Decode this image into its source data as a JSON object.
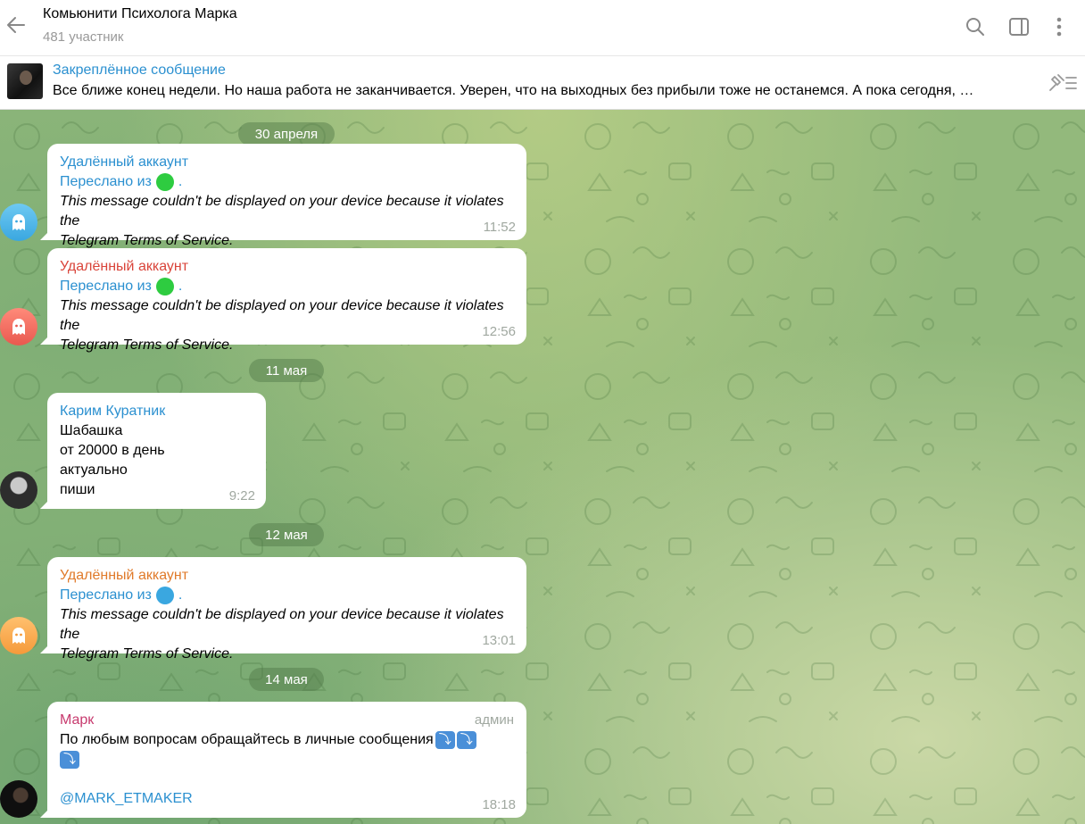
{
  "header": {
    "title": "Комьюнити Психолога Марка",
    "subtitle": "481 участник"
  },
  "pinned": {
    "title": "Закреплённое сообщение",
    "text": "Все ближе конец недели. Но наша работа не заканчивается. Уверен, что на выходных без прибыли тоже не останемся. А пока сегодня, …"
  },
  "dates": {
    "d1": "30 апреля",
    "d2": "11 мая",
    "d3": "12 мая",
    "d4": "14 мая"
  },
  "messages": [
    {
      "sender": "Удалённый аккаунт",
      "sender_color": "#2b90d0",
      "forward_prefix": "Переслано из",
      "forward_dot_color": "#2ecc40",
      "forward_suffix": ".",
      "line1": "This message couldn't be displayed on your device because it violates the",
      "line2": "Telegram Terms of Service.",
      "time": "11:52"
    },
    {
      "sender": "Удалённый аккаунт",
      "sender_color": "#d9443a",
      "forward_prefix": "Переслано из",
      "forward_dot_color": "#2ecc40",
      "forward_suffix": ".",
      "line1": "This message couldn't be displayed on your device because it violates the",
      "line2": "Telegram Terms of Service.",
      "time": "12:56"
    },
    {
      "sender": "Карим Куратник",
      "sender_color": "#2b90d0",
      "lines": [
        "Шабашка",
        "от 20000 в день",
        "актуально",
        "пиши"
      ],
      "time": "9:22"
    },
    {
      "sender": "Удалённый аккаунт",
      "sender_color": "#e07a2a",
      "forward_prefix": "Переслано из",
      "forward_dot_color": "#3aa7e0",
      "forward_suffix": ".",
      "line1": "This message couldn't be displayed on your device because it violates the",
      "line2": "Telegram Terms of Service.",
      "time": "13:01"
    },
    {
      "sender": "Марк",
      "sender_color": "#c73a6e",
      "role": "админ",
      "text": "По любым вопросам обращайтесь в личные сообщения",
      "emoji_icon": "arrow-down-right-emoji",
      "emoji_glyph": "⤵",
      "mention": "@MARK_ETMAKER",
      "time": "18:18"
    }
  ]
}
